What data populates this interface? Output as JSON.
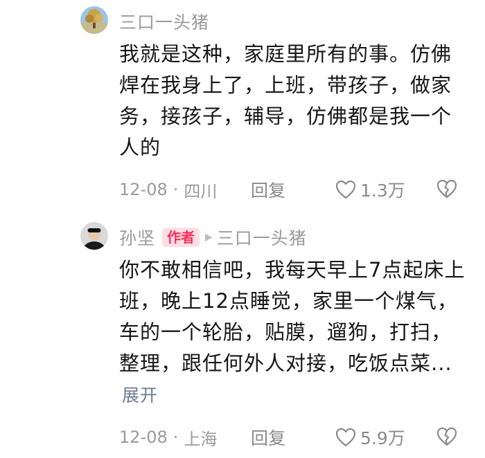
{
  "comments": [
    {
      "username": "三口一头猪",
      "text": "我就是这种，家庭里所有的事。仿佛焊在我身上了，上班，带孩子，做家务，接孩子，辅导，仿佛都是我一个人的",
      "date": "12-08",
      "separator": "·",
      "location": "四川",
      "reply_label": "回复",
      "like_count": "1.3万",
      "avatar_icon": "tree-landscape-avatar",
      "like_icon": "heart-outline-icon",
      "dislike_icon": "broken-heart-icon"
    },
    {
      "username": "孙坚",
      "author_badge": "作者",
      "reply_to": "三口一头猪",
      "text": "你不敢相信吧，我每天早上7点起床上班，晚上12点睡觉，家里一个煤气，车的一个轮胎，贴膜，遛狗，打扫，整理，跟任何外人对接，吃饭点菜...",
      "expand_label": "展开",
      "date": "12-08",
      "separator": "·",
      "location": "上海",
      "reply_label": "回复",
      "like_count": "5.9万",
      "avatar_icon": "person-portrait-avatar",
      "like_icon": "heart-outline-icon",
      "dislike_icon": "broken-heart-icon"
    }
  ],
  "colors": {
    "text_primary": "#161616",
    "text_secondary": "#9a9a9a",
    "badge_bg": "#fde0e6",
    "badge_text": "#fe2c55",
    "link": "#6b7a91"
  }
}
